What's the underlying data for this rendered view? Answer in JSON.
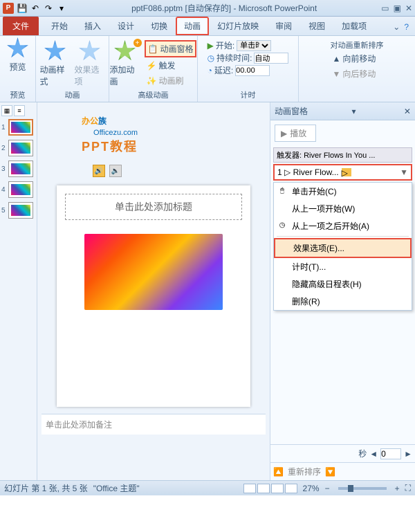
{
  "title": "pptF086.pptm [自动保存的] - Microsoft PowerPoint",
  "tabs": {
    "file": "文件",
    "list": [
      "开始",
      "插入",
      "设计",
      "切换",
      "动画",
      "幻灯片放映",
      "审阅",
      "视图",
      "加载项"
    ],
    "activeIndex": 4
  },
  "ribbon": {
    "preview": {
      "btn": "预览",
      "group": "预览"
    },
    "anim": {
      "style": "动画样式",
      "options": "效果选项",
      "group": "动画"
    },
    "adv": {
      "add": "添加动画",
      "pane": "动画窗格",
      "trigger": "触发",
      "painter": "动画刷",
      "group": "高级动画"
    },
    "timing": {
      "start": "开始:",
      "startVal": "单击时",
      "dur": "持续时间:",
      "durVal": "自动",
      "delay": "延迟:",
      "delayVal": "00.00",
      "group": "计时"
    },
    "reorder": {
      "title": "对动画重新排序",
      "up": "向前移动",
      "down": "向后移动"
    }
  },
  "watermark": {
    "brand1": "办公",
    "brand2": "族",
    "url": "Officezu.com",
    "sub": "PPT教程"
  },
  "thumbs": [
    "1",
    "2",
    "3",
    "4",
    "5"
  ],
  "slide": {
    "title_ph": "单击此处添加标题",
    "notes_ph": "单击此处添加备注"
  },
  "pane": {
    "title": "动画窗格",
    "play": "播放",
    "trigger": "触发器: River Flows In You ...",
    "item": "1 ▷ River Flow...",
    "menu": {
      "click": "单击开始(C)",
      "withPrev": "从上一项开始(W)",
      "afterPrev": "从上一项之后开始(A)",
      "effect": "效果选项(E)...",
      "timing": "计时(T)...",
      "hide": "隐藏高级日程表(H)",
      "remove": "删除(R)"
    },
    "sec": "秒",
    "secVal": "0",
    "reorder": "重新排序"
  },
  "status": {
    "slide": "幻灯片 第 1 张, 共 5 张",
    "theme": "\"Office 主题\"",
    "zoom": "27%"
  }
}
